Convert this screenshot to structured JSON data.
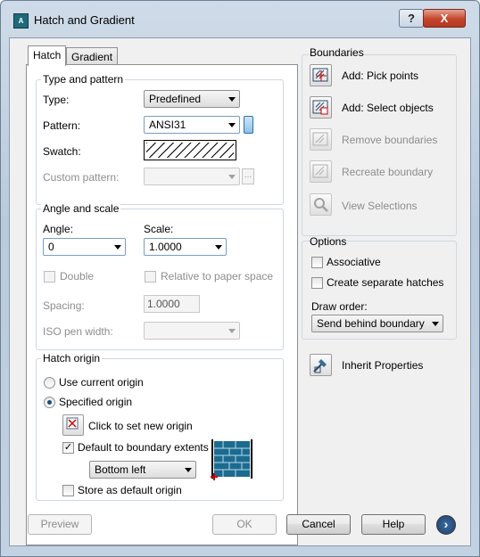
{
  "window": {
    "title": "Hatch and Gradient",
    "help_glyph": "?",
    "close_glyph": "X"
  },
  "tabs": {
    "hatch": "Hatch",
    "gradient": "Gradient"
  },
  "type_pattern": {
    "group_title": "Type and pattern",
    "type_label": "Type:",
    "type_value": "Predefined",
    "pattern_label": "Pattern:",
    "pattern_value": "ANSI31",
    "swatch_label": "Swatch:",
    "custom_label": "Custom pattern:",
    "custom_value": "",
    "browse_glyph": "..."
  },
  "angle_scale": {
    "group_title": "Angle and scale",
    "angle_label": "Angle:",
    "angle_value": "0",
    "scale_label": "Scale:",
    "scale_value": "1.0000",
    "double_label": "Double",
    "relative_label": "Relative to paper space",
    "spacing_label": "Spacing:",
    "spacing_value": "1.0000",
    "iso_label": "ISO pen width:",
    "iso_value": ""
  },
  "hatch_origin": {
    "group_title": "Hatch origin",
    "use_current": "Use current origin",
    "specified": "Specified origin",
    "click_set": "Click to set new origin",
    "default_extents": "Default to boundary extents",
    "position_value": "Bottom left",
    "store_default": "Store as default origin"
  },
  "boundaries": {
    "title": "Boundaries",
    "pick_points": "Add: Pick points",
    "select_objects": "Add: Select objects",
    "remove": "Remove boundaries",
    "recreate": "Recreate boundary",
    "view": "View Selections"
  },
  "options": {
    "title": "Options",
    "associative": "Associative",
    "separate": "Create separate hatches",
    "draw_order_label": "Draw order:",
    "draw_order_value": "Send behind boundary"
  },
  "inherit": "Inherit Properties",
  "footer": {
    "preview": "Preview",
    "ok": "OK",
    "cancel": "Cancel",
    "help": "Help",
    "more_glyph": "›"
  }
}
